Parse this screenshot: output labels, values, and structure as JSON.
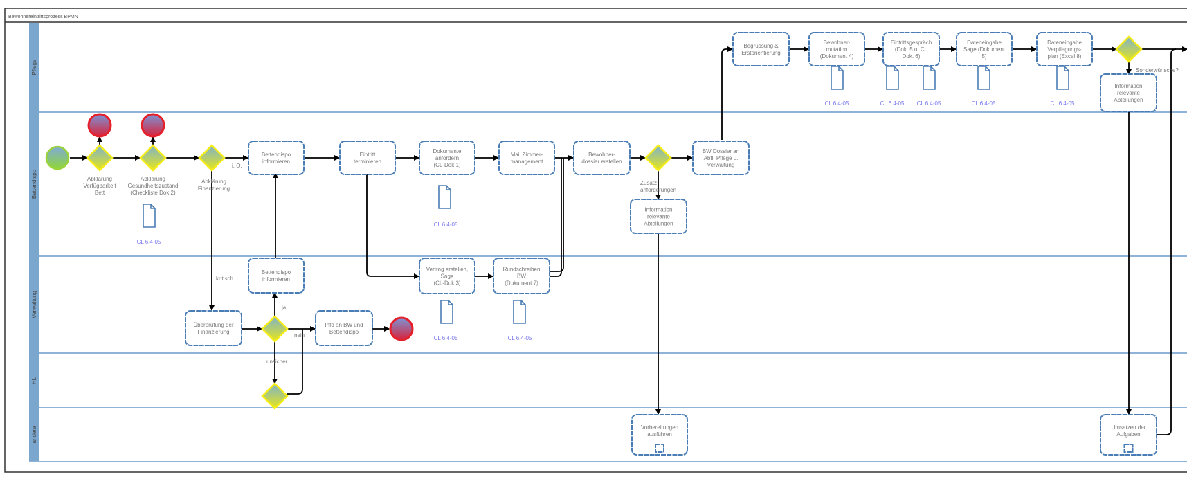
{
  "title": "Bewohnereintrittsprozess BPMN",
  "lanes": [
    {
      "label": "Pflege"
    },
    {
      "label": "Bettendispo"
    },
    {
      "label": "Verwaltung"
    },
    {
      "label": "HL"
    },
    {
      "label": "andere"
    }
  ],
  "colors": {
    "lane_band": "#7ba7cf",
    "lane_line": "#8fb3d6",
    "task_border": "#4a7db5",
    "gateway_border": "#f5ec1a",
    "start_border": "#9ad33a",
    "end_border": "#e5202a",
    "doc_ref": "#7777ee"
  },
  "events": {
    "start": {
      "name": "start-event"
    },
    "end1": {
      "name": "end-event"
    },
    "end2": {
      "name": "end-event"
    },
    "end3": {
      "name": "end-event"
    }
  },
  "gateways": {
    "g1": {
      "label": [
        "Abklärung",
        "Verfügbarkeit",
        "Bett"
      ]
    },
    "g2": {
      "label": [
        "Abklärung",
        "Gesundheitszustand",
        "(Checkliste Dok 2)"
      ]
    },
    "g3": {
      "label": [
        "Abklärung",
        "Finanzierung"
      ]
    },
    "g4": {
      "label": []
    },
    "g5": {
      "label": []
    },
    "g6": {
      "label": []
    },
    "g7": {
      "label": []
    }
  },
  "tasks": {
    "t_bettendispo1": [
      "Bettendispo",
      "informieren"
    ],
    "t_eintritt": [
      "Eintritt",
      "terminieren"
    ],
    "t_dokumente": [
      "Dokumente",
      "anfordern",
      "(CL-Dok 1)"
    ],
    "t_mail": [
      "Mail Zimmer-",
      "management"
    ],
    "t_dossier": [
      "Bewohner-",
      "dossier erstellen"
    ],
    "t_bwdossier": [
      "BW Dossier an",
      "Abtl. Pflege u.",
      "Verwaltung"
    ],
    "t_info1": [
      "Information",
      "relevante",
      "Abteilungen"
    ],
    "t_begruessung": [
      "Begrüssung &",
      "Erstorientierung"
    ],
    "t_mutation": [
      "Bewohner-",
      "mutation",
      "(Dokument 4)"
    ],
    "t_eintrittsgespraech": [
      "Eintrittsgespräch",
      "(Dok. 5 u. CL",
      "Dok. 6)"
    ],
    "t_sage": [
      "Dateneingabe",
      "Sage (Dokument",
      "5)"
    ],
    "t_verpflegung": [
      "Dateneingabe",
      "Verpflegungs-",
      "plan (Excel 8)"
    ],
    "t_info2": [
      "Information",
      "relevante",
      "Abteilungen"
    ],
    "t_bettendispo2": [
      "Bettendispo",
      "informieren"
    ],
    "t_ueberpruefung": [
      "Überprüfung der",
      "Finanzierung"
    ],
    "t_infobw": [
      "Info an BW und",
      "Bettendispo"
    ],
    "t_vertrag": [
      "Vertrag erstellen,",
      "Sage",
      "(CL-Dok 3)"
    ],
    "t_rundschreiben": [
      "Rundschreiben",
      "BW",
      "(Dokument 7)"
    ],
    "t_vorbereitungen": [
      "Vorbereitungen",
      "ausführen"
    ],
    "t_umsetzen": [
      "Umsetzen der",
      "Aufgaben"
    ]
  },
  "flow_labels": {
    "io": "i. O.",
    "kritisch": "kritisch",
    "ja": "ja",
    "nein": "nein",
    "unsicher": "unsicher",
    "zusatz": [
      "Zusatz-",
      "anforderungen"
    ],
    "sonderwuensche": "Sonderwünsche?"
  },
  "doc_refs": {
    "ref": "CL 6.4-05"
  }
}
